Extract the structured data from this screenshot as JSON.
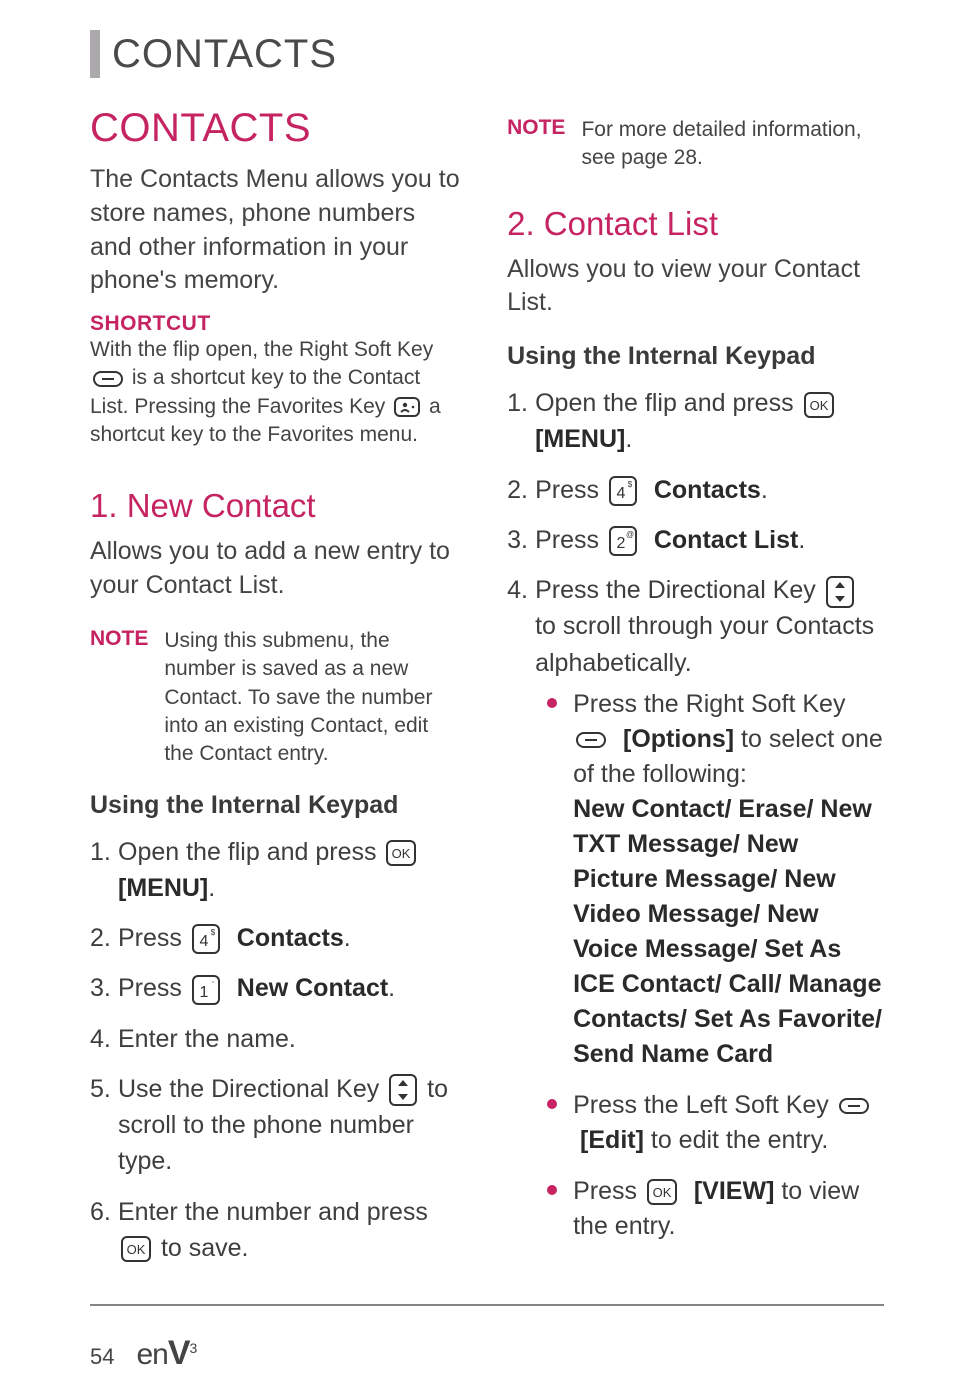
{
  "header": {
    "title": "CONTACTS"
  },
  "left": {
    "section_title": "CONTACTS",
    "intro": "The Contacts Menu allows you to store names, phone numbers and other information in your phone's memory.",
    "shortcut_label": "SHORTCUT",
    "shortcut_line1a": "With the flip open, the Right Soft Key ",
    "shortcut_line1b": " is a shortcut key to the Contact List.",
    "shortcut_line2a": "Pressing the Favorites Key ",
    "shortcut_line2b": " a shortcut key to the Favorites menu.",
    "h_newcontact": "1. New Contact",
    "newcontact_intro": "Allows you to add a new entry to your Contact List.",
    "note1_label": "NOTE",
    "note1_text": "Using this submenu, the number is saved as a new Contact. To save the number into an existing Contact, edit the Contact entry.",
    "kb_head": "Using the Internal Keypad",
    "steps": {
      "s1a": "Open the flip and press ",
      "s1b": "[MENU]",
      "s2a": "Press ",
      "s2b": "Contacts",
      "s3a": "Press ",
      "s3b": "New Contact",
      "s4": "Enter the name.",
      "s5a": "Use the Directional Key ",
      "s5b": " to scroll to the phone number type.",
      "s6a": "Enter the number and press ",
      "s6b": " to save."
    }
  },
  "right": {
    "note2_label": "NOTE",
    "note2_text": "For more detailed information, see page 28.",
    "h_contactlist": "2. Contact List",
    "contactlist_intro": "Allows you to view your Contact List.",
    "kb_head": "Using the Internal Keypad",
    "steps": {
      "s1a": "Open the flip and press ",
      "s1b": "[MENU]",
      "s2a": "Press ",
      "s2b": "Contacts",
      "s3a": "Press ",
      "s3b": "Contact List",
      "s4a": "Press the Directional Key ",
      "s4b": " to scroll through your Contacts alphabetically."
    },
    "bullets": {
      "b1a": "Press the Right Soft Key ",
      "b1b": "[Options]",
      "b1c": " to select one of the following:",
      "b1d": "New Contact/ Erase/ New TXT Message/ New Picture Message/ New Video Message/ New Voice Message/ Set As ICE Contact/ Call/ Manage Contacts/ Set As Favorite/ Send Name Card",
      "b2a": "Press the Left Soft Key ",
      "b2b": "[Edit]",
      "b2c": " to edit the entry.",
      "b3a": "Press ",
      "b3b": "[VIEW]",
      "b3c": " to view the entry."
    }
  },
  "footer": {
    "page": "54",
    "logo_en": "en",
    "logo_v": "V",
    "logo_sup": "3"
  }
}
